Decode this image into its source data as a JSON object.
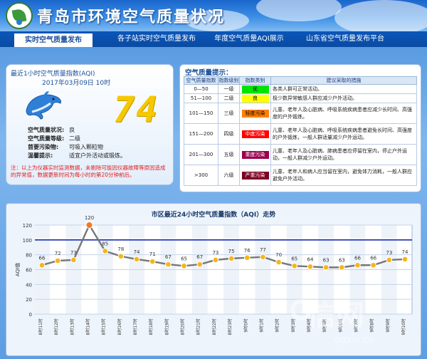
{
  "header": {
    "site_title": "青岛市环境空气质量状况"
  },
  "nav": [
    {
      "label": "实时空气质量发布",
      "active": true
    },
    {
      "label": "各子站实时空气质量发布",
      "active": false
    },
    {
      "label": "年度空气质量AQI展示",
      "active": false
    },
    {
      "label": "山东省空气质量发布平台",
      "active": false
    }
  ],
  "realtime": {
    "title": "最近1小时空气质量指数(AQI)",
    "time": "2017年03月09日 10时",
    "aqi_value": "74",
    "rows": [
      {
        "label": "空气质量状况:",
        "value": "良"
      },
      {
        "label": "空气质量等级:",
        "value": "二级"
      },
      {
        "label": "首要污染物:",
        "value": "可吸入颗粒物"
      },
      {
        "label": "温馨提示:",
        "value": "适宜户外活动或锻炼。"
      }
    ],
    "note": "注：以上为仪器实时监测数据，未剔除可能因仪器故障等原因造成的异常值，数据更新时间为每小时的第20分钟前后。"
  },
  "standard": {
    "title": "空气质量提示：",
    "headers": [
      "空气质量指数",
      "指数级别",
      "指数类别",
      "建议采取的措施"
    ],
    "rows": [
      {
        "range": "0—50",
        "level": "一级",
        "category": "优",
        "color": "#00e400",
        "text_color": "#000000",
        "advice": "各类人群可正常活动。"
      },
      {
        "range": "51—100",
        "level": "二级",
        "category": "良",
        "color": "#ffff00",
        "text_color": "#000000",
        "advice": "极少数异常敏感人群应减少户外活动。"
      },
      {
        "range": "101—150",
        "level": "三级",
        "category": "轻度污染",
        "color": "#ff7e00",
        "text_color": "#000000",
        "advice": "儿童、老年人及心脏病、呼吸系统疾病患者应减少长时间、高强度的户外锻炼。"
      },
      {
        "range": "151—200",
        "level": "四级",
        "category": "中度污染",
        "color": "#ff0000",
        "text_color": "#ffffff",
        "advice": "儿童、老年人及心脏病、呼吸系统疾病患者避免长时间、高强度的户外锻炼，一般人群适量减少户外运动。"
      },
      {
        "range": "201—300",
        "level": "五级",
        "category": "重度污染",
        "color": "#99004c",
        "text_color": "#ffffff",
        "advice": "儿童、老年人及心脏病、肺病患者应停留在室内，停止户外运动，一般人群减少户外运动。"
      },
      {
        "range": ">300",
        "level": "六级",
        "category": "严重污染",
        "color": "#7e0023",
        "text_color": "#ffffff",
        "advice": "儿童、老年人和病人应当留在室内，避免体力消耗，一般人群应避免户外活动。"
      }
    ]
  },
  "chart_data": {
    "type": "line",
    "title": "市区最近24小时空气质量指数（AQI）走势",
    "ylabel": "AQI值",
    "ylim": [
      0,
      120
    ],
    "yticks": [
      0,
      20,
      40,
      60,
      80,
      100,
      120
    ],
    "reference_line": 100,
    "categories": [
      "8时11时",
      "8时12时",
      "8时13时",
      "8时14时",
      "8时15时",
      "8时16时",
      "8时17时",
      "8时18时",
      "8时19时",
      "8时20时",
      "8时21时",
      "8时22时",
      "8时23时",
      "9时0时",
      "9时1时",
      "9时2时",
      "9时3时",
      "9时4时",
      "9时5时",
      "9时6时",
      "9时7时",
      "9时8时",
      "9时9时",
      "9时10时"
    ],
    "values": [
      66,
      72,
      73,
      120,
      85,
      78,
      74,
      71,
      67,
      65,
      67,
      73,
      75,
      76,
      77,
      70,
      65,
      64,
      63,
      63,
      66,
      66,
      73,
      74
    ],
    "point_color": "#f6b619",
    "max_point_color": "#f07a22",
    "line_color": "#777777"
  },
  "watermark": {
    "text": "信网",
    "sub": "qdxin.cn"
  }
}
